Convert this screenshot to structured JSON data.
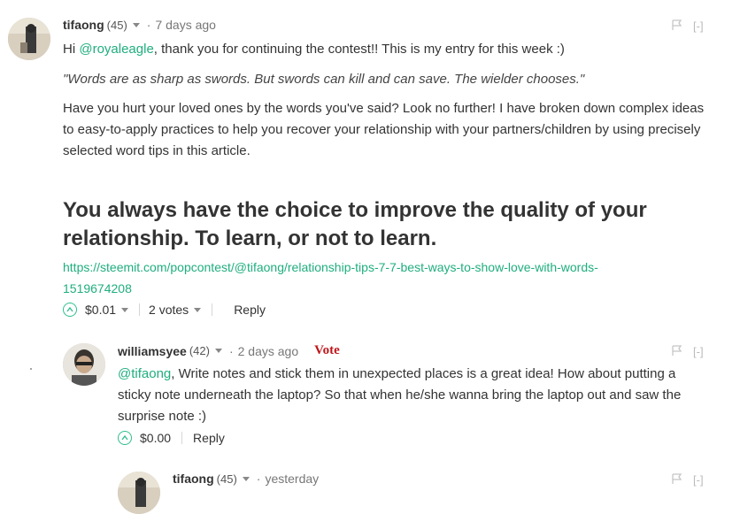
{
  "comments": [
    {
      "author": "tifaong",
      "reputation": "(45)",
      "time": "7 days ago",
      "greeting_prefix": "Hi ",
      "mention": "@royaleagle",
      "greeting_rest": ", thank you for continuing the contest!! This is my entry for this week :)",
      "quote": "\"Words are as sharp as swords. But swords can kill and can save. The wielder chooses.\"",
      "paragraph_line1": "Have you hurt your loved ones by the words you've said? Look no further! I have broken down complex ideas",
      "paragraph_line2": "to easy-to-apply practices to help you recover your relationship with your partners/children by using precisely",
      "paragraph_line3": "selected word tips in this article.",
      "heading_line1": "You always have the choice to improve the quality of your",
      "heading_line2": "relationship. To learn, or not to learn.",
      "link_line1": "https://steemit.com/popcontest/@tifaong/relationship-tips-7-7-best-ways-to-show-love-with-words-",
      "link_line2": "1519674208",
      "payout": "$0.01",
      "votes": "2 votes",
      "reply": "Reply",
      "flag_icon": "flag-icon",
      "collapse": "[-]"
    },
    {
      "author": "williamsyee",
      "reputation": "(42)",
      "time": "2 days ago",
      "vote_label": "Vote",
      "mention": "@tifaong",
      "line1_rest": ", Write notes and stick them in unexpected places is a great idea! How about putting a",
      "line2": "sticky note underneath the laptop? So that when he/she wanna bring the laptop out and saw the",
      "line3": "surprise note :)",
      "payout": "$0.00",
      "reply": "Reply",
      "collapse": "[-]"
    },
    {
      "author": "tifaong",
      "reputation": "(45)",
      "time": "yesterday",
      "collapse": "[-]"
    }
  ],
  "colors": {
    "link": "#1fae7f",
    "vote_red": "#c0161a",
    "upvote": "#2fbf8a"
  }
}
